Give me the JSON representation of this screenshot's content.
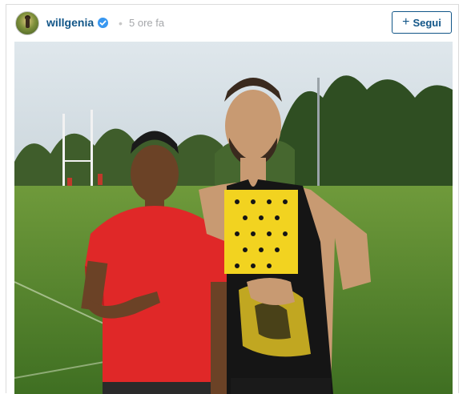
{
  "post": {
    "username": "willgenia",
    "separator": "•",
    "time": "5 ore fa",
    "follow_label": "Segui",
    "follow_plus": "+"
  },
  "icons": {
    "avatar": "avatar",
    "verified": "verified-badge-icon",
    "follow": "plus-icon"
  },
  "colors": {
    "username": "#125688",
    "verified": "#3897f0",
    "time": "#a5a7aa",
    "button_border": "#125688"
  }
}
